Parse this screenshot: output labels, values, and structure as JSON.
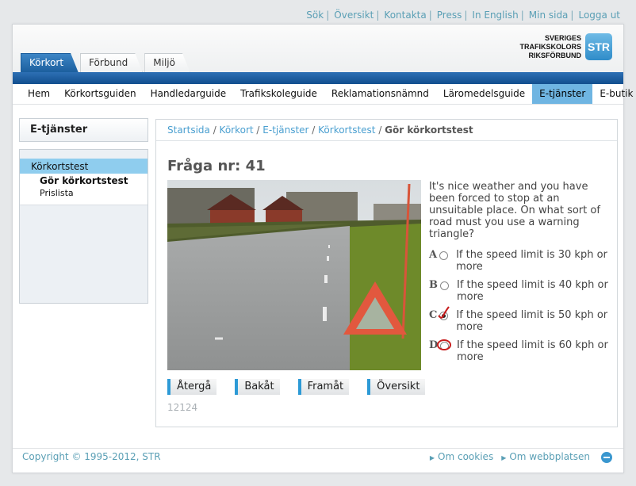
{
  "utility_links": [
    "Sök",
    "Översikt",
    "Kontakta",
    "Press",
    "In English",
    "Min sida",
    "Logga ut"
  ],
  "tabs": [
    "Körkort",
    "Förbund",
    "Miljö"
  ],
  "logo": {
    "line1": "SVERIGES",
    "line2": "TRAFIKSKOLORS",
    "line3": "RIKSFÖRBUND",
    "mark": "STR"
  },
  "nav": [
    "Hem",
    "Körkortsguiden",
    "Handledarguide",
    "Trafikskoleguide",
    "Reklamationsnämnd",
    "Läromedelsguide",
    "E-tjänster",
    "E-butik"
  ],
  "sidebar": {
    "title": "E-tjänster",
    "item": "Körkortstest",
    "sub_active": "Gör körkortstest",
    "sub2": "Prislista"
  },
  "breadcrumb": {
    "home": "Startsida",
    "l1": "Körkort",
    "l2": "E-tjänster",
    "l3": "Körkortstest",
    "current": "Gör körkortstest"
  },
  "question": {
    "title": "Fråga nr: 41",
    "text": "It's nice weather and you have been forced to stop at an unsuitable place. On what sort of road must you use a warning triangle?",
    "options": [
      {
        "letter": "A",
        "text": "If the speed limit is 30 kph or more"
      },
      {
        "letter": "B",
        "text": "If the speed limit is 40 kph or more"
      },
      {
        "letter": "C",
        "text": "If the speed limit is 50 kph or more"
      },
      {
        "letter": "D",
        "text": "If the speed limit is 60 kph or more"
      }
    ],
    "id": "12124"
  },
  "buttons": {
    "back": "Återgå",
    "prev": "Bakåt",
    "next": "Framåt",
    "overview": "Översikt"
  },
  "footer": {
    "copyright": "Copyright © 1995-2012, STR",
    "cookies": "Om cookies",
    "about": "Om webbplatsen"
  },
  "colors": {
    "accent": "#1a5d9c",
    "link": "#4a9fd0",
    "nav_active": "#6fb5e2",
    "mark": "#c81e1e"
  }
}
